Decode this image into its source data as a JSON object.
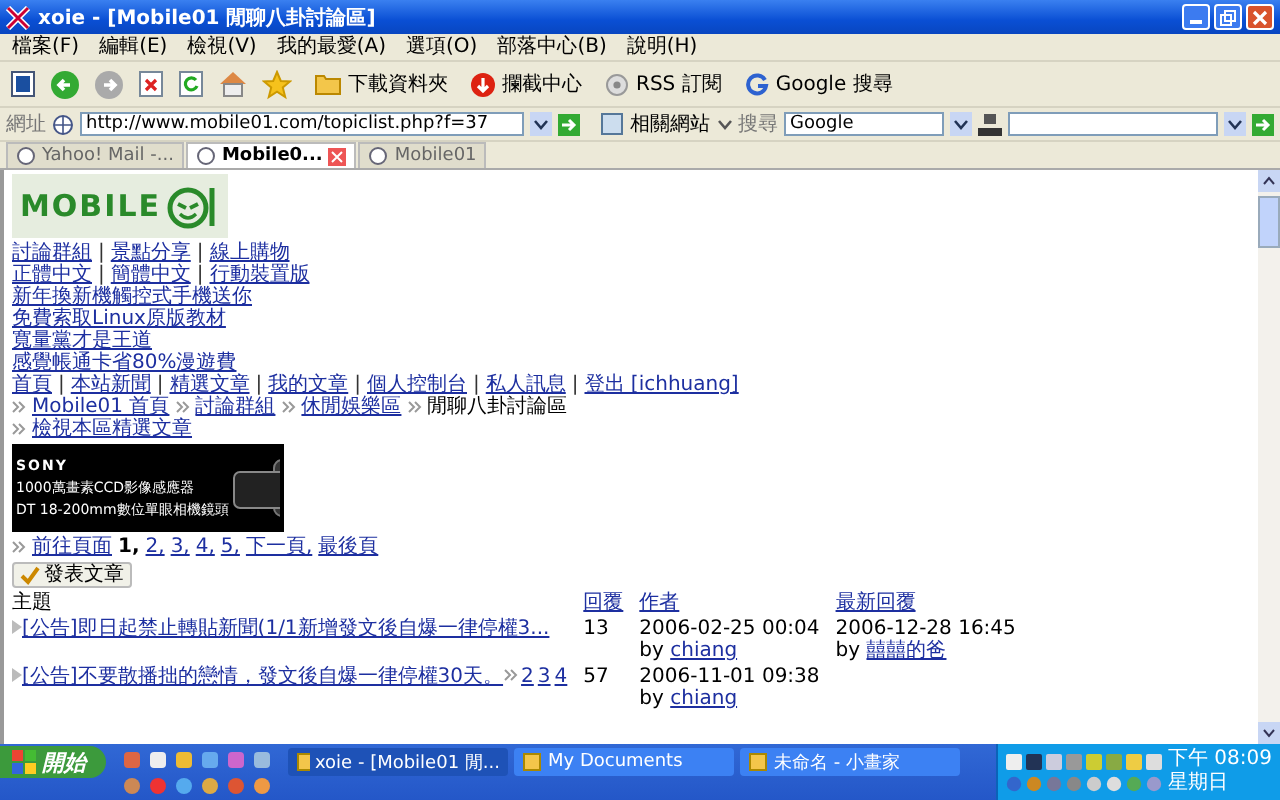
{
  "window": {
    "title": "xoie - [Mobile01 閒聊八卦討論區]"
  },
  "menu": [
    "檔案(F)",
    "編輯(E)",
    "檢視(V)",
    "我的最愛(A)",
    "選項(O)",
    "部落中心(B)",
    "說明(H)"
  ],
  "toolbar": [
    {
      "label": "下載資料夾",
      "kind": "folder"
    },
    {
      "label": "攔截中心",
      "kind": "block"
    },
    {
      "label": "RSS 訂閱",
      "kind": "rss"
    },
    {
      "label": "Google 搜尋",
      "kind": "google"
    }
  ],
  "address_bar": {
    "label": "網址",
    "value": "http://www.mobile01.com/topiclist.php?f=37",
    "related": "相關網站",
    "search_label": "搜尋",
    "search_value": "Google"
  },
  "tabs": [
    {
      "label": "Yahoo! Mail -...",
      "selected": false
    },
    {
      "label": "Mobile0...",
      "selected": true
    },
    {
      "label": "Mobile01",
      "selected": false
    }
  ],
  "page": {
    "logo": "MOBILE",
    "nav_separator": "|",
    "nav_rows": [
      [
        "討論群組",
        "景點分享",
        "線上購物"
      ],
      [
        "正體中文",
        "簡體中文",
        "行動裝置版"
      ]
    ],
    "promos": [
      "新年換新機觸控式手機送你",
      "免費索取Linux原版教材",
      "寬量黨才是王道",
      "感覺帳通卡省80%漫遊費"
    ],
    "user_links": [
      "首頁",
      "本站新聞",
      "精選文章",
      "我的文章",
      "個人控制台",
      "私人訊息",
      "登出 [ichhuang]"
    ],
    "breadcrumb": [
      {
        "label": "Mobile01 首頁",
        "link": true
      },
      {
        "label": "討論群組",
        "link": true
      },
      {
        "label": "休閒娛樂區",
        "link": true
      },
      {
        "label": "閒聊八卦討論區",
        "link": false
      }
    ],
    "featured_link": "檢視本區精選文章",
    "banner": {
      "brand": "SONY",
      "line_1": "1000萬畫素CCD影像感應器",
      "line_2": "DT 18-200mm數位單眼相機鏡頭"
    },
    "pager": {
      "label": "前往頁面",
      "pages": [
        {
          "label": "1,",
          "selected": true
        },
        {
          "label": "2,",
          "selected": false
        },
        {
          "label": "3,",
          "selected": false
        },
        {
          "label": "4,",
          "selected": false
        },
        {
          "label": "5,",
          "selected": false
        },
        {
          "label": "下一頁,",
          "selected": false
        },
        {
          "label": "最後頁",
          "selected": false
        }
      ]
    },
    "post_button": "發表文章",
    "topics": {
      "columns": [
        "主題",
        "回覆",
        "作者",
        "最新回覆"
      ],
      "rows": [
        {
          "title": "[公告]即日起禁止轉貼新聞(1/1新增發文後自爆一律停權3...",
          "pages": [],
          "replies": "13",
          "author_date": "2006-02-25 00:04",
          "author_by": "by",
          "author": "chiang",
          "last_date": "2006-12-28 16:45",
          "last_by": "by",
          "last_user": "囍囍的爸"
        },
        {
          "title": "[公告]不要散播拙的戀情，發文後自爆一律停權30天。",
          "pages": [
            "2",
            "3",
            "4"
          ],
          "replies": "57",
          "author_date": "2006-11-01 09:38",
          "author_by": "by",
          "author": "chiang"
        }
      ]
    }
  },
  "taskbar": {
    "start": "開始",
    "tasks": [
      {
        "label": "xoie - [Mobile01 閒...",
        "selected": true
      },
      {
        "label": "My Documents",
        "selected": false
      },
      {
        "label": "未命名 - 小畫家",
        "selected": false
      }
    ],
    "time": "下午 08:09",
    "day": "星期日"
  }
}
